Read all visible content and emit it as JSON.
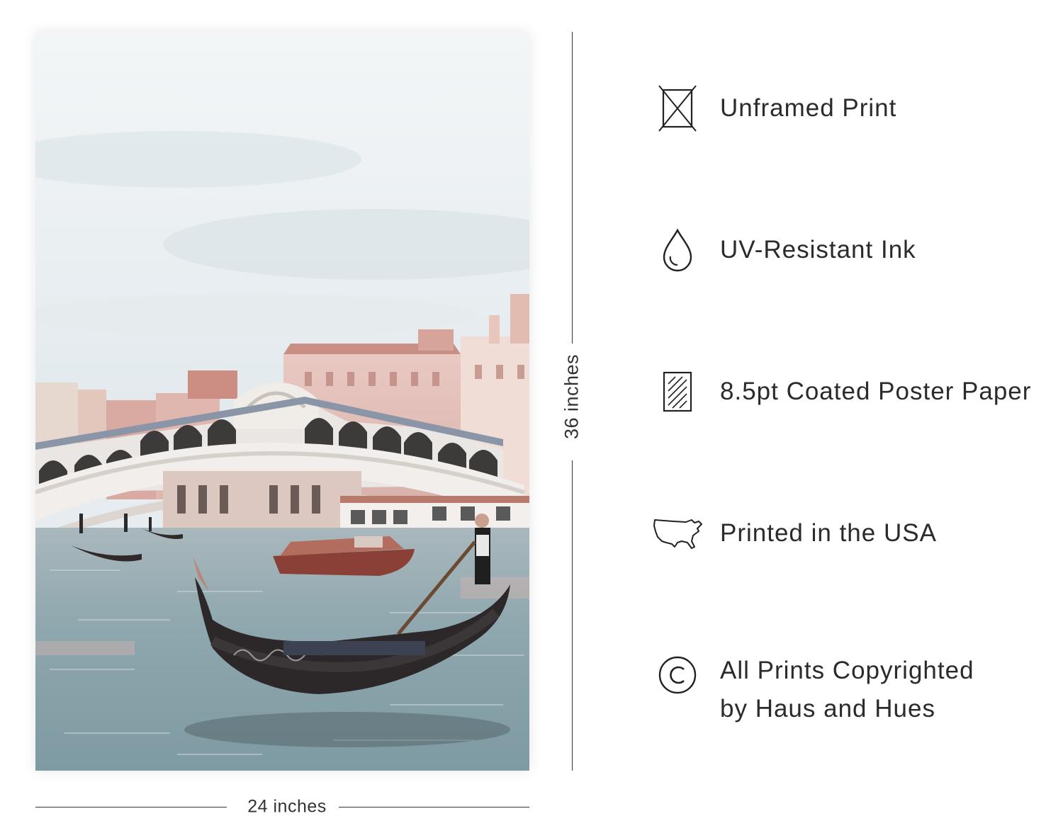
{
  "dimensions": {
    "height_label": "36 inches",
    "width_label": "24 inches"
  },
  "features": [
    {
      "icon": "unframed-box-icon",
      "label": "Unframed Print"
    },
    {
      "icon": "ink-drop-icon",
      "label": "UV-Resistant Ink"
    },
    {
      "icon": "coated-paper-icon",
      "label": "8.5pt Coated Poster Paper"
    },
    {
      "icon": "usa-map-icon",
      "label": "Printed in the USA"
    },
    {
      "icon": "copyright-icon",
      "label_line1": "All Prints Copyrighted",
      "label_line2": "by Haus and Hues"
    }
  ]
}
